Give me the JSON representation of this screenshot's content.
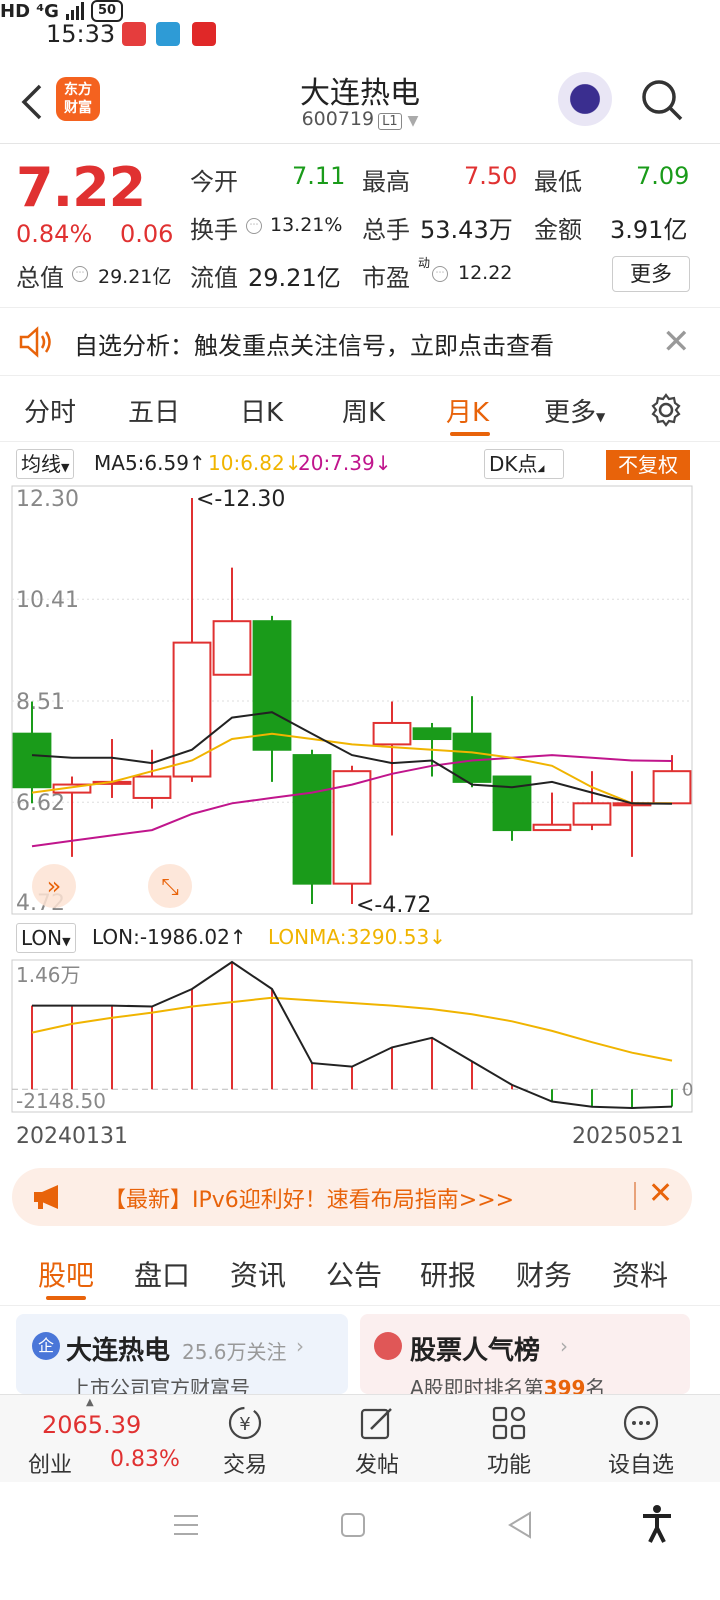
{
  "status_bar": {
    "time": "15:33",
    "network": "HD ⁴G",
    "battery": "50"
  },
  "header": {
    "back_icon": "back-arrow-icon",
    "logo_line1": "东方",
    "logo_line2": "财富",
    "title": "大连热电",
    "code": "600719",
    "level": "L1"
  },
  "quote": {
    "price": "7.22",
    "change_pct": "0.84%",
    "change": "0.06",
    "open_label": "今开",
    "open": "7.11",
    "high_label": "最高",
    "high": "7.50",
    "low_label": "最低",
    "low": "7.09",
    "turnover_label": "换手",
    "turnover": "13.21%",
    "volume_label": "总手",
    "volume": "53.43万",
    "amount_label": "金额",
    "amount": "3.91亿",
    "mktcap_label": "总值",
    "mktcap": "29.21亿",
    "float_label": "流值",
    "float_cap": "29.21亿",
    "pe_label": "市盈",
    "pe_sup": "动",
    "pe": "12.22",
    "more_button": "更多"
  },
  "notice": {
    "text": "自选分析：触发重点关注信号，立即点击查看"
  },
  "chart_tabs": {
    "items": [
      "分时",
      "五日",
      "日K",
      "周K",
      "月K",
      "更多"
    ],
    "active": "月K"
  },
  "ma_bar": {
    "select": "均线",
    "ma5": "MA5:6.59↑",
    "ma10": "10:6.82↓",
    "ma20": "20:7.39↓",
    "dk": "DK点",
    "adjust": "不复权"
  },
  "price_axis": {
    "labels": [
      "12.30",
      "10.41",
      "8.51",
      "6.62",
      "4.72"
    ],
    "max_marker": "<-12.30",
    "min_marker": "<-4.72"
  },
  "lon_bar": {
    "select": "LON",
    "lon": "LON:-1986.02↑",
    "lonma": "LONMA:3290.53↓"
  },
  "lon_axis": {
    "top": "1.46万",
    "bottom": "-2148.50",
    "zero": "0"
  },
  "date_axis": {
    "start": "20240131",
    "end": "20250521"
  },
  "colors": {
    "up": "#e03131",
    "down": "#1a9b1a",
    "accent": "#e8630a",
    "ma5": "#222222",
    "ma10": "#f0b400",
    "ma20": "#c0158c"
  },
  "chart_data": {
    "type": "candlestick",
    "title": "",
    "ylim": [
      4.72,
      12.3
    ],
    "candles": [
      {
        "open": 7.9,
        "close": 6.9,
        "high": 8.5,
        "low": 6.6
      },
      {
        "open": 6.8,
        "close": 6.95,
        "high": 7.1,
        "low": 5.6
      },
      {
        "open": 7.0,
        "close": 7.0,
        "high": 7.8,
        "low": 6.7
      },
      {
        "open": 6.7,
        "close": 7.1,
        "high": 7.6,
        "low": 6.5
      },
      {
        "open": 7.1,
        "close": 9.6,
        "high": 12.3,
        "low": 7.0
      },
      {
        "open": 9.0,
        "close": 10.0,
        "high": 11.0,
        "low": 9.0
      },
      {
        "open": 10.0,
        "close": 7.6,
        "high": 10.1,
        "low": 7.0
      },
      {
        "open": 7.5,
        "close": 5.1,
        "high": 7.6,
        "low": 4.72
      },
      {
        "open": 5.1,
        "close": 7.2,
        "high": 7.3,
        "low": 4.72
      },
      {
        "open": 7.7,
        "close": 8.1,
        "high": 8.5,
        "low": 6.0
      },
      {
        "open": 8.0,
        "close": 7.8,
        "high": 8.1,
        "low": 7.1
      },
      {
        "open": 7.9,
        "close": 7.0,
        "high": 8.6,
        "low": 6.9
      },
      {
        "open": 7.1,
        "close": 6.1,
        "high": 7.1,
        "low": 5.9
      },
      {
        "open": 6.1,
        "close": 6.2,
        "high": 6.8,
        "low": 6.1
      },
      {
        "open": 6.2,
        "close": 6.6,
        "high": 7.2,
        "low": 6.1
      },
      {
        "open": 6.6,
        "close": 6.6,
        "high": 7.2,
        "low": 5.6
      },
      {
        "open": 6.6,
        "close": 7.2,
        "high": 7.5,
        "low": 6.6
      }
    ],
    "ma5": [
      7.5,
      7.45,
      7.45,
      7.35,
      7.6,
      8.2,
      8.3,
      7.9,
      7.5,
      7.35,
      7.4,
      6.95,
      6.9,
      7.0,
      6.8,
      6.6,
      6.59
    ],
    "ma10": [
      6.8,
      6.9,
      7.0,
      7.2,
      7.4,
      7.8,
      7.9,
      7.8,
      7.7,
      7.65,
      7.6,
      7.55,
      7.45,
      7.3,
      6.9,
      6.6,
      6.6
    ],
    "ma20": [
      5.8,
      5.9,
      6.0,
      6.1,
      6.4,
      6.6,
      6.7,
      6.8,
      6.95,
      7.15,
      7.3,
      7.4,
      7.45,
      7.5,
      7.45,
      7.4,
      7.39
    ],
    "lon": [
      9600,
      9600,
      9600,
      9500,
      11500,
      14600,
      11500,
      3000,
      2600,
      4800,
      5900,
      3200,
      500,
      -1400,
      -2000,
      -2148.5,
      -1986.02
    ],
    "lonma": [
      6500,
      7500,
      8200,
      8800,
      9500,
      10000,
      10500,
      10200,
      9900,
      9600,
      9200,
      8600,
      7800,
      6700,
      5400,
      4200,
      3290.53
    ]
  },
  "banner": {
    "text": "【最新】IPv6迎利好！速看布局指南>>>"
  },
  "news_tabs": {
    "items": [
      "股吧",
      "盘口",
      "资讯",
      "公告",
      "研报",
      "财务",
      "资料"
    ]
  },
  "card1": {
    "title": "大连热电",
    "follow": "25.6万关注",
    "sub": "上市公司官方财富号"
  },
  "card2": {
    "title": "股票人气榜",
    "sub_a": "A股即时排名第",
    "rank": "399",
    "sub_b": "名"
  },
  "bottom_nav": {
    "index_value": "2065.39",
    "index_name": "创业",
    "index_pct": "0.83%",
    "trade": "交易",
    "post": "发帖",
    "func": "功能",
    "fav": "设自选"
  }
}
